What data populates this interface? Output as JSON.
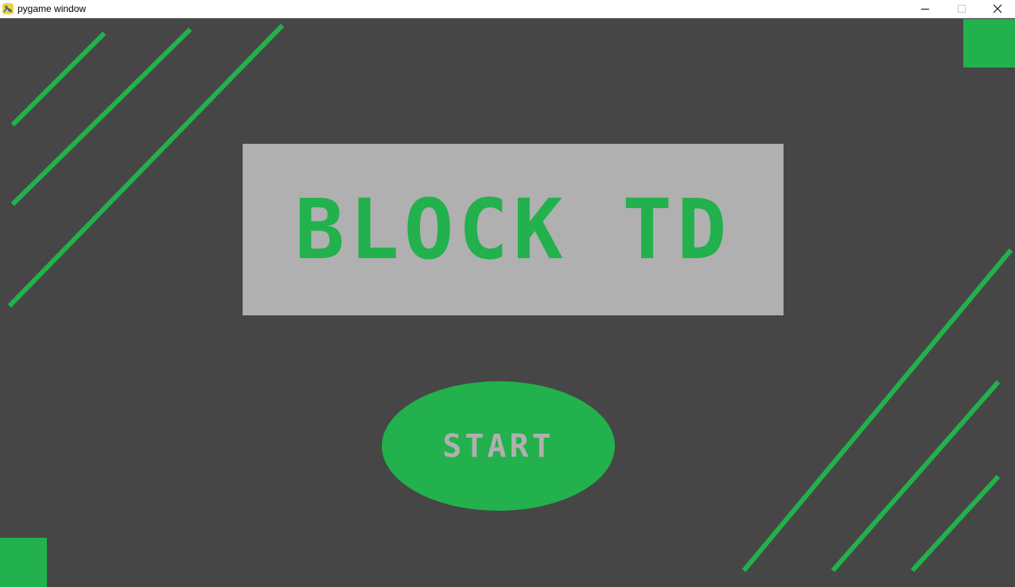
{
  "window": {
    "title": "pygame window",
    "controls": {
      "minimize_icon": "minimize-icon",
      "maximize_icon": "maximize-icon",
      "close_icon": "close-icon"
    }
  },
  "game": {
    "title": "BLOCK TD",
    "start_label": "START"
  },
  "colors": {
    "background": "#464646",
    "accent": "#22b14c",
    "panel": "#b0b0b0"
  }
}
